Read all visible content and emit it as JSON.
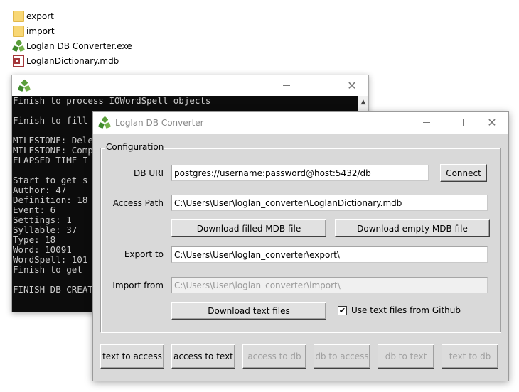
{
  "files": [
    {
      "name": "export",
      "icon": "folder-icon"
    },
    {
      "name": "import",
      "icon": "folder-icon"
    },
    {
      "name": "Loglan DB Converter.exe",
      "icon": "recycle-app-icon"
    },
    {
      "name": "LoglanDictionary.mdb",
      "icon": "access-file-icon"
    }
  ],
  "console": {
    "title": "",
    "lines": [
      "Finish to process IOWordSpell objects",
      "",
      "Finish to fill",
      "",
      "MILESTONE: Dele",
      "MILESTONE: Comp",
      "ELAPSED TIME I",
      "",
      "Start to get s",
      "Author: 47",
      "Definition: 18",
      "Event: 6",
      "Settings: 1",
      "Syllable: 37",
      "Type: 18",
      "Word: 10091",
      "WordSpell: 101",
      "Finish to get ",
      "",
      "FINISH DB CREAT"
    ]
  },
  "app": {
    "title": "Loglan DB Converter",
    "groupbox_label": "Configuration",
    "db_uri": {
      "label": "DB URI",
      "value": "postgres://username:password@host:5432/db"
    },
    "connect_button": "Connect",
    "access_path": {
      "label": "Access Path",
      "value": "C:\\Users\\User\\loglan_converter\\LoglanDictionary.mdb"
    },
    "download_filled_button": "Download filled MDB file",
    "download_empty_button": "Download empty MDB file",
    "export_to": {
      "label": "Export to",
      "value": "C:\\Users\\User\\loglan_converter\\export\\"
    },
    "import_from": {
      "label": "Import from",
      "value": "C:\\Users\\User\\loglan_converter\\import\\",
      "disabled": true
    },
    "download_text_button": "Download text files",
    "use_github_checkbox": {
      "label": "Use text files from Github",
      "checked": true
    },
    "actions": [
      {
        "label": "text to access",
        "enabled": true
      },
      {
        "label": "access to text",
        "enabled": true
      },
      {
        "label": "access to db",
        "enabled": false
      },
      {
        "label": "db to access",
        "enabled": false
      },
      {
        "label": "db to text",
        "enabled": false
      },
      {
        "label": "text to db",
        "enabled": false
      }
    ]
  }
}
